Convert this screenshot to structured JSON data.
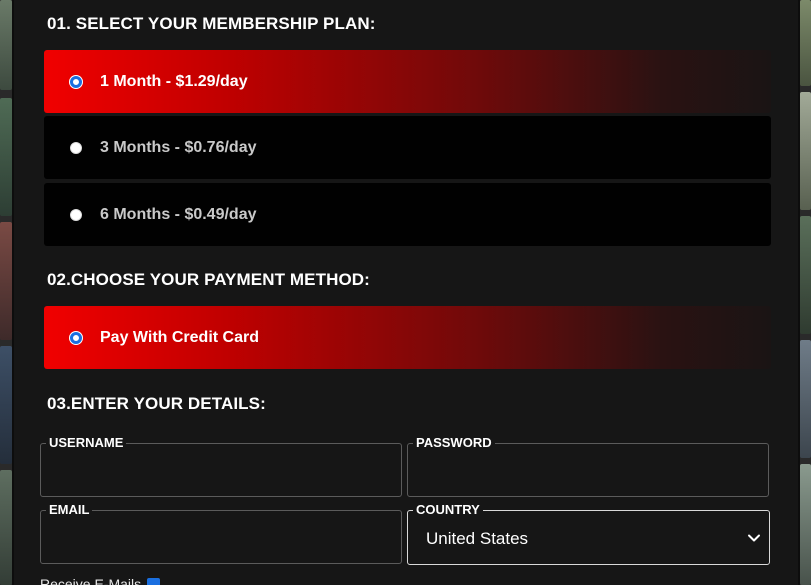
{
  "sections": {
    "plan_title": "01. SELECT YOUR MEMBERSHIP PLAN:",
    "payment_title": "02.CHOOSE YOUR PAYMENT METHOD:",
    "details_title": "03.ENTER YOUR DETAILS:"
  },
  "plans": [
    {
      "label": "1 Month - $1.29/day",
      "selected": true
    },
    {
      "label": "3 Months - $0.76/day",
      "selected": false
    },
    {
      "label": "6 Months - $0.49/day",
      "selected": false
    }
  ],
  "payment_methods": [
    {
      "label": "Pay With Credit Card",
      "selected": true
    }
  ],
  "form": {
    "username_label": "USERNAME",
    "username_value": "",
    "password_label": "PASSWORD",
    "password_value": "",
    "email_label": "EMAIL",
    "email_value": "",
    "country_label": "COUNTRY",
    "country_value": "United States"
  },
  "bottom": {
    "partial_label": "Receive E-Mails",
    "checked": true
  },
  "colors": {
    "selected_gradient_start": "#f10000",
    "selected_gradient_end": "#1a1414",
    "unselected_bg": "#010101",
    "radio_accent": "#1a6fe0",
    "panel_bg": "#161616"
  }
}
